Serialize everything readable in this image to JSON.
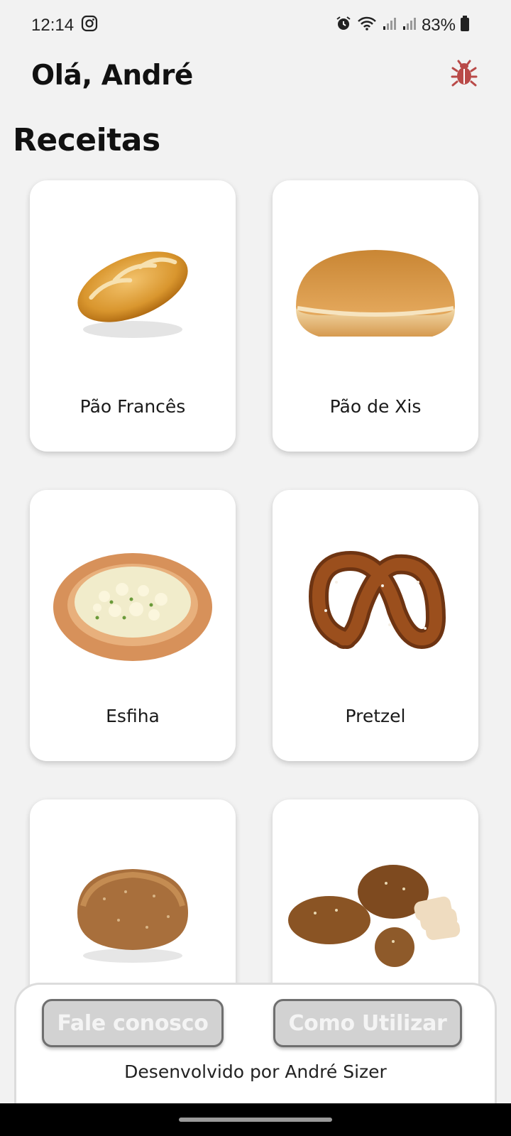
{
  "status_bar": {
    "time": "12:14",
    "battery": "83%",
    "icons": [
      "instagram-icon",
      "alarm-icon",
      "wifi-icon",
      "signal-icon",
      "signal-icon",
      "battery-icon"
    ]
  },
  "header": {
    "greeting": "Olá, André",
    "action_icon": "bug-icon",
    "action_color": "#b94a48"
  },
  "section": {
    "title": "Receitas"
  },
  "recipes": [
    {
      "name": "Pão Francês",
      "image": "french-bread"
    },
    {
      "name": "Pão de Xis",
      "image": "burger-bun"
    },
    {
      "name": "Esfiha",
      "image": "esfiha"
    },
    {
      "name": "Pretzel",
      "image": "pretzel"
    },
    {
      "name": "",
      "image": "wholegrain-loaf"
    },
    {
      "name": "",
      "image": "multigrain-breads"
    }
  ],
  "footer": {
    "contact_label": "Fale conosco",
    "howto_label": "Como Utilizar",
    "credit": "Desenvolvido por André Sizer"
  }
}
